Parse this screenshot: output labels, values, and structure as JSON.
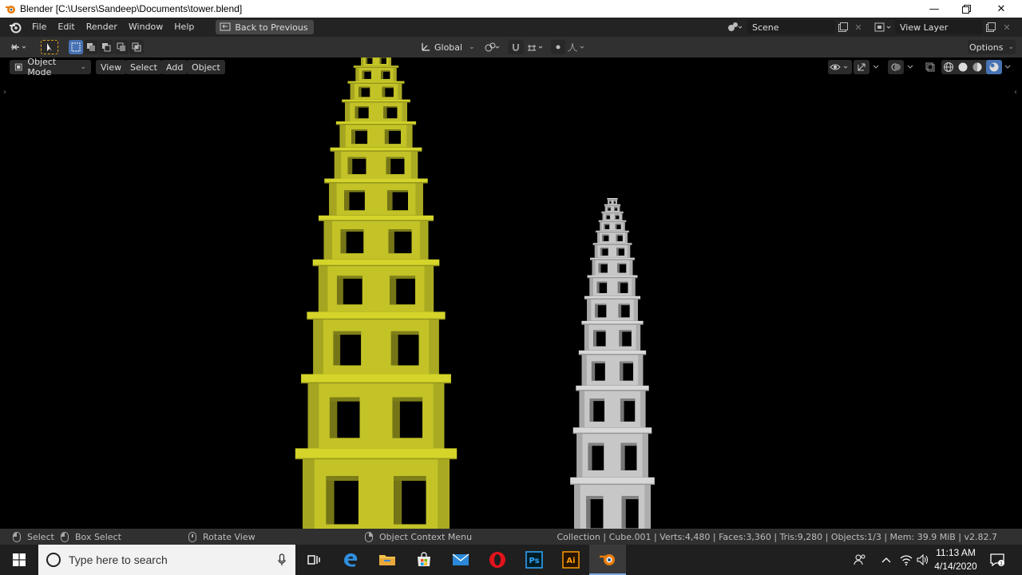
{
  "window": {
    "title": "Blender [C:\\Users\\Sandeep\\Documents\\tower.blend]"
  },
  "topbar": {
    "menus": [
      "File",
      "Edit",
      "Render",
      "Window",
      "Help"
    ],
    "back_button": "Back to Previous",
    "scene": "Scene",
    "view_layer": "View Layer"
  },
  "header": {
    "transform_orientation": "Global",
    "options": "Options"
  },
  "viewport": {
    "mode": "Object Mode",
    "menus": [
      "View",
      "Select",
      "Add",
      "Object"
    ],
    "colors": {
      "yellow_tower": "#d4d42a",
      "white_tower": "#d8d8d8",
      "background": "#000000"
    }
  },
  "statusbar": {
    "select": "Select",
    "box_select": "Box Select",
    "rotate_view": "Rotate View",
    "context_menu": "Object Context Menu",
    "stats": "Collection | Cube.001 | Verts:4,480 | Faces:3,360 | Tris:9,280 | Objects:1/3 | Mem: 39.9 MiB | v2.82.7"
  },
  "taskbar": {
    "search_placeholder": "Type here to search",
    "time": "11:13 AM",
    "date": "4/14/2020",
    "apps": [
      "task-view",
      "edge",
      "file-explorer",
      "store",
      "mail",
      "opera",
      "photoshop",
      "illustrator",
      "blender"
    ]
  }
}
